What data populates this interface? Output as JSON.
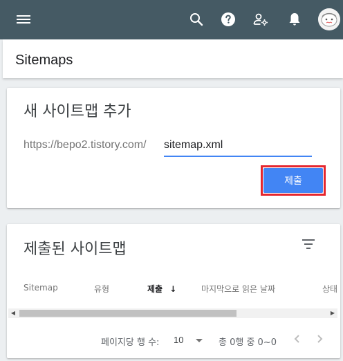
{
  "topbar": {
    "icons": [
      "menu-icon",
      "search-icon",
      "help-icon",
      "user-settings-icon",
      "notifications-icon",
      "avatar"
    ],
    "background": "#455a64"
  },
  "header": {
    "title": "Sitemaps"
  },
  "add_sitemap": {
    "title": "새 사이트맵 추가",
    "url_prefix": "https://bepo2.tistory.com/",
    "input_value": "sitemap.xml",
    "submit_label": "제출",
    "accent": "#4285f4",
    "highlight": "#e5262e"
  },
  "submitted_sitemaps": {
    "title": "제출된 사이트맵",
    "columns": [
      {
        "label": "Sitemap"
      },
      {
        "label": "유형"
      },
      {
        "label": "제출",
        "sorted": "descending"
      },
      {
        "label": "마지막으로 읽은 날짜"
      },
      {
        "label": "상태"
      }
    ],
    "sort_arrow": "↓",
    "footer": {
      "rows_per_page_label": "페이지당 행 수:",
      "rows_per_page_value": "10",
      "range_text": "총 0행 중 0~0"
    }
  }
}
